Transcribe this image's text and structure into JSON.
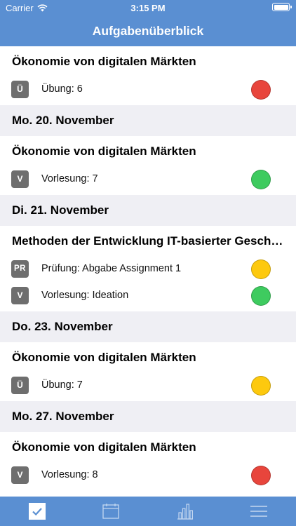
{
  "status_bar": {
    "carrier": "Carrier",
    "time": "3:15 PM"
  },
  "nav": {
    "title": "Aufgabenüberblick"
  },
  "status_colors": {
    "red": "#e8453c",
    "green": "#3ecb5f",
    "yellow": "#fdc90e"
  },
  "sections": [
    {
      "date": "",
      "course": "Ökonomie von digitalen Märkten",
      "tasks": [
        {
          "badge": "Ü",
          "label": "Übung: 6",
          "status": "red"
        }
      ]
    },
    {
      "date": "Mo. 20. November",
      "course": "Ökonomie von digitalen Märkten",
      "tasks": [
        {
          "badge": "V",
          "label": "Vorlesung: 7",
          "status": "green"
        }
      ]
    },
    {
      "date": "Di. 21. November",
      "course": "Methoden der Entwicklung IT-basierter Geschäftsmodelle",
      "tasks": [
        {
          "badge": "PR",
          "label": "Prüfung: Abgabe Assignment 1",
          "status": "yellow"
        },
        {
          "badge": "V",
          "label": "Vorlesung: Ideation",
          "status": "green"
        }
      ]
    },
    {
      "date": "Do. 23. November",
      "course": "Ökonomie von digitalen Märkten",
      "tasks": [
        {
          "badge": "Ü",
          "label": "Übung: 7",
          "status": "yellow"
        }
      ]
    },
    {
      "date": "Mo. 27. November",
      "course": "Ökonomie von digitalen Märkten",
      "tasks": [
        {
          "badge": "V",
          "label": "Vorlesung: 8",
          "status": "red"
        }
      ]
    }
  ],
  "tab_bar": {
    "tabs": [
      {
        "icon": "checkmark-icon",
        "selected": true
      },
      {
        "icon": "calendar-icon",
        "selected": false
      },
      {
        "icon": "bar-chart-icon",
        "selected": false
      },
      {
        "icon": "hamburger-menu-icon",
        "selected": false
      }
    ]
  }
}
